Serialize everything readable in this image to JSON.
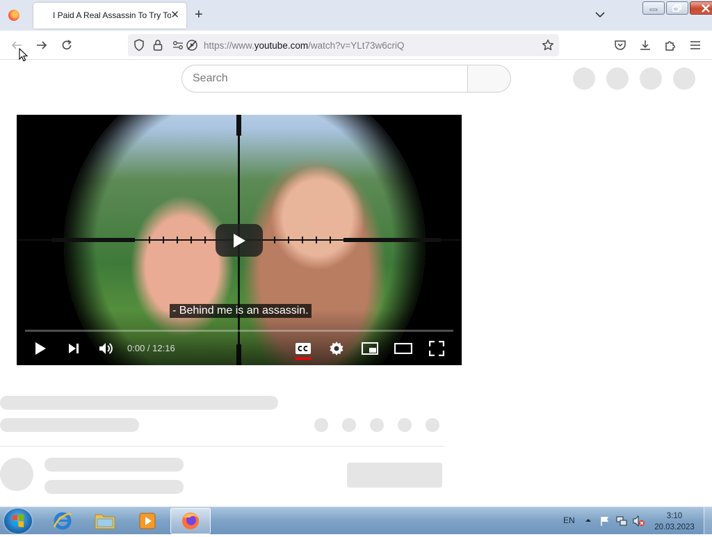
{
  "browser": {
    "tab": {
      "title": "I Paid A Real Assassin To Try To"
    },
    "new_tab_label": "+",
    "close_tab_label": "✕",
    "url": {
      "scheme_host": "https://www.",
      "domain": "youtube.com",
      "path": "/watch?v=YLt73w6criQ"
    }
  },
  "youtube": {
    "search": {
      "placeholder": "Search"
    },
    "player": {
      "caption": "- Behind me is an assassin.",
      "time_display": "0:00 / 12:16",
      "progress_fraction": 0.0
    }
  },
  "taskbar": {
    "language": "EN",
    "clock_time": "3:10",
    "clock_date": "20.03.2023"
  }
}
